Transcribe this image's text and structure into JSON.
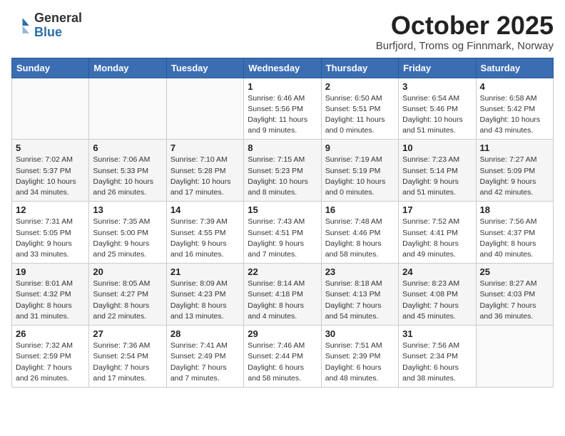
{
  "header": {
    "logo_general": "General",
    "logo_blue": "Blue",
    "month_title": "October 2025",
    "subtitle": "Burfjord, Troms og Finnmark, Norway"
  },
  "days_of_week": [
    "Sunday",
    "Monday",
    "Tuesday",
    "Wednesday",
    "Thursday",
    "Friday",
    "Saturday"
  ],
  "weeks": [
    [
      {
        "day": "",
        "info": ""
      },
      {
        "day": "",
        "info": ""
      },
      {
        "day": "",
        "info": ""
      },
      {
        "day": "1",
        "info": "Sunrise: 6:46 AM\nSunset: 5:56 PM\nDaylight: 11 hours\nand 9 minutes."
      },
      {
        "day": "2",
        "info": "Sunrise: 6:50 AM\nSunset: 5:51 PM\nDaylight: 11 hours\nand 0 minutes."
      },
      {
        "day": "3",
        "info": "Sunrise: 6:54 AM\nSunset: 5:46 PM\nDaylight: 10 hours\nand 51 minutes."
      },
      {
        "day": "4",
        "info": "Sunrise: 6:58 AM\nSunset: 5:42 PM\nDaylight: 10 hours\nand 43 minutes."
      }
    ],
    [
      {
        "day": "5",
        "info": "Sunrise: 7:02 AM\nSunset: 5:37 PM\nDaylight: 10 hours\nand 34 minutes."
      },
      {
        "day": "6",
        "info": "Sunrise: 7:06 AM\nSunset: 5:33 PM\nDaylight: 10 hours\nand 26 minutes."
      },
      {
        "day": "7",
        "info": "Sunrise: 7:10 AM\nSunset: 5:28 PM\nDaylight: 10 hours\nand 17 minutes."
      },
      {
        "day": "8",
        "info": "Sunrise: 7:15 AM\nSunset: 5:23 PM\nDaylight: 10 hours\nand 8 minutes."
      },
      {
        "day": "9",
        "info": "Sunrise: 7:19 AM\nSunset: 5:19 PM\nDaylight: 10 hours\nand 0 minutes."
      },
      {
        "day": "10",
        "info": "Sunrise: 7:23 AM\nSunset: 5:14 PM\nDaylight: 9 hours\nand 51 minutes."
      },
      {
        "day": "11",
        "info": "Sunrise: 7:27 AM\nSunset: 5:09 PM\nDaylight: 9 hours\nand 42 minutes."
      }
    ],
    [
      {
        "day": "12",
        "info": "Sunrise: 7:31 AM\nSunset: 5:05 PM\nDaylight: 9 hours\nand 33 minutes."
      },
      {
        "day": "13",
        "info": "Sunrise: 7:35 AM\nSunset: 5:00 PM\nDaylight: 9 hours\nand 25 minutes."
      },
      {
        "day": "14",
        "info": "Sunrise: 7:39 AM\nSunset: 4:55 PM\nDaylight: 9 hours\nand 16 minutes."
      },
      {
        "day": "15",
        "info": "Sunrise: 7:43 AM\nSunset: 4:51 PM\nDaylight: 9 hours\nand 7 minutes."
      },
      {
        "day": "16",
        "info": "Sunrise: 7:48 AM\nSunset: 4:46 PM\nDaylight: 8 hours\nand 58 minutes."
      },
      {
        "day": "17",
        "info": "Sunrise: 7:52 AM\nSunset: 4:41 PM\nDaylight: 8 hours\nand 49 minutes."
      },
      {
        "day": "18",
        "info": "Sunrise: 7:56 AM\nSunset: 4:37 PM\nDaylight: 8 hours\nand 40 minutes."
      }
    ],
    [
      {
        "day": "19",
        "info": "Sunrise: 8:01 AM\nSunset: 4:32 PM\nDaylight: 8 hours\nand 31 minutes."
      },
      {
        "day": "20",
        "info": "Sunrise: 8:05 AM\nSunset: 4:27 PM\nDaylight: 8 hours\nand 22 minutes."
      },
      {
        "day": "21",
        "info": "Sunrise: 8:09 AM\nSunset: 4:23 PM\nDaylight: 8 hours\nand 13 minutes."
      },
      {
        "day": "22",
        "info": "Sunrise: 8:14 AM\nSunset: 4:18 PM\nDaylight: 8 hours\nand 4 minutes."
      },
      {
        "day": "23",
        "info": "Sunrise: 8:18 AM\nSunset: 4:13 PM\nDaylight: 7 hours\nand 54 minutes."
      },
      {
        "day": "24",
        "info": "Sunrise: 8:23 AM\nSunset: 4:08 PM\nDaylight: 7 hours\nand 45 minutes."
      },
      {
        "day": "25",
        "info": "Sunrise: 8:27 AM\nSunset: 4:03 PM\nDaylight: 7 hours\nand 36 minutes."
      }
    ],
    [
      {
        "day": "26",
        "info": "Sunrise: 7:32 AM\nSunset: 2:59 PM\nDaylight: 7 hours\nand 26 minutes."
      },
      {
        "day": "27",
        "info": "Sunrise: 7:36 AM\nSunset: 2:54 PM\nDaylight: 7 hours\nand 17 minutes."
      },
      {
        "day": "28",
        "info": "Sunrise: 7:41 AM\nSunset: 2:49 PM\nDaylight: 7 hours\nand 7 minutes."
      },
      {
        "day": "29",
        "info": "Sunrise: 7:46 AM\nSunset: 2:44 PM\nDaylight: 6 hours\nand 58 minutes."
      },
      {
        "day": "30",
        "info": "Sunrise: 7:51 AM\nSunset: 2:39 PM\nDaylight: 6 hours\nand 48 minutes."
      },
      {
        "day": "31",
        "info": "Sunrise: 7:56 AM\nSunset: 2:34 PM\nDaylight: 6 hours\nand 38 minutes."
      },
      {
        "day": "",
        "info": ""
      }
    ]
  ]
}
